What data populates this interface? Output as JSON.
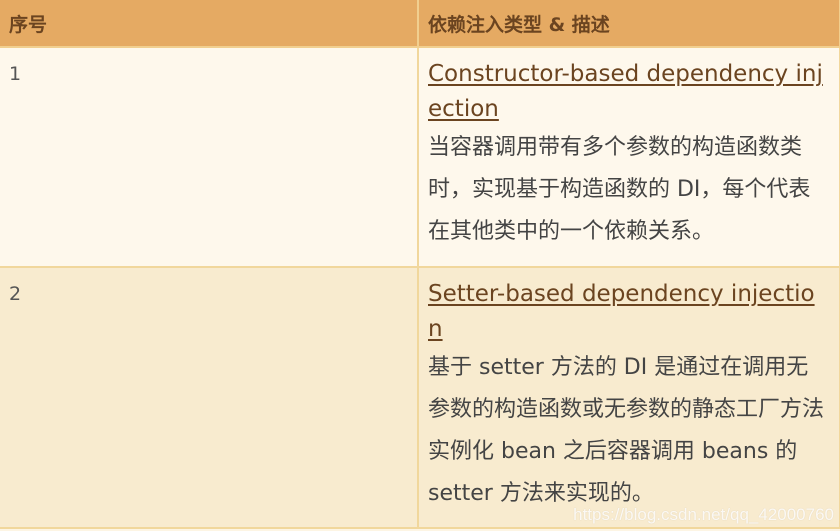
{
  "table": {
    "headers": [
      "序号",
      "依赖注入类型 & 描述"
    ],
    "rows": [
      {
        "number": "1",
        "link_text": "Constructor-based dependency injection",
        "description": "当容器调用带有多个参数的构造函数类时，实现基于构造函数的 DI，每个代表在其他类中的一个依赖关系。"
      },
      {
        "number": "2",
        "link_text": "Setter-based dependency injection",
        "description": "基于 setter 方法的 DI 是通过在调用无参数的构造函数或无参数的静态工厂方法实例化 bean 之后容器调用 beans 的 setter 方法来实现的。"
      }
    ]
  },
  "watermark": "https://blog.csdn.net/qq_42000760",
  "colors": {
    "header_bg": "#e5aa63",
    "header_text": "#6b4420",
    "row_odd_bg": "#fef8ec",
    "row_even_bg": "#f8ebcf",
    "border": "#f1d79c",
    "link": "#6b4420"
  }
}
